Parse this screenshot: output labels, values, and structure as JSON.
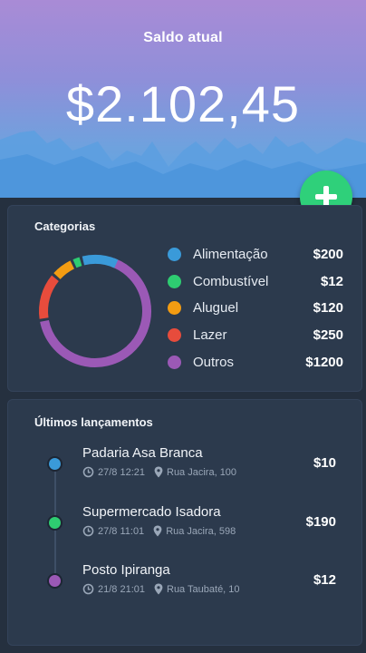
{
  "header": {
    "title": "Saldo atual",
    "balance": "$2.102,45"
  },
  "fab": {
    "icon": "plus-icon"
  },
  "categories": {
    "title": "Categorias",
    "items": [
      {
        "name": "Alimentação",
        "value": "$200",
        "color": "#3a9ad9",
        "share": 200
      },
      {
        "name": "Combustível",
        "value": "$12",
        "color": "#2ecc71",
        "share": 12
      },
      {
        "name": "Aluguel",
        "value": "$120",
        "color": "#f39c12",
        "share": 120
      },
      {
        "name": "Lazer",
        "value": "$250",
        "color": "#e74c3c",
        "share": 250
      },
      {
        "name": "Outros",
        "value": "$1200",
        "color": "#9b59b6",
        "share": 1200
      }
    ]
  },
  "recent": {
    "title": "Últimos lançamentos",
    "items": [
      {
        "name": "Padaria Asa Branca",
        "date": "27/8 12:21",
        "place": "Rua Jacira, 100",
        "amount": "$10",
        "color": "#3a9ad9"
      },
      {
        "name": "Supermercado Isadora",
        "date": "27/8 11:01",
        "place": "Rua Jacira, 598",
        "amount": "$190",
        "color": "#2ecc71"
      },
      {
        "name": "Posto Ipiranga",
        "date": "21/8 21:01",
        "place": "Rua Taubaté, 10",
        "amount": "$12",
        "color": "#9b59b6"
      }
    ]
  }
}
